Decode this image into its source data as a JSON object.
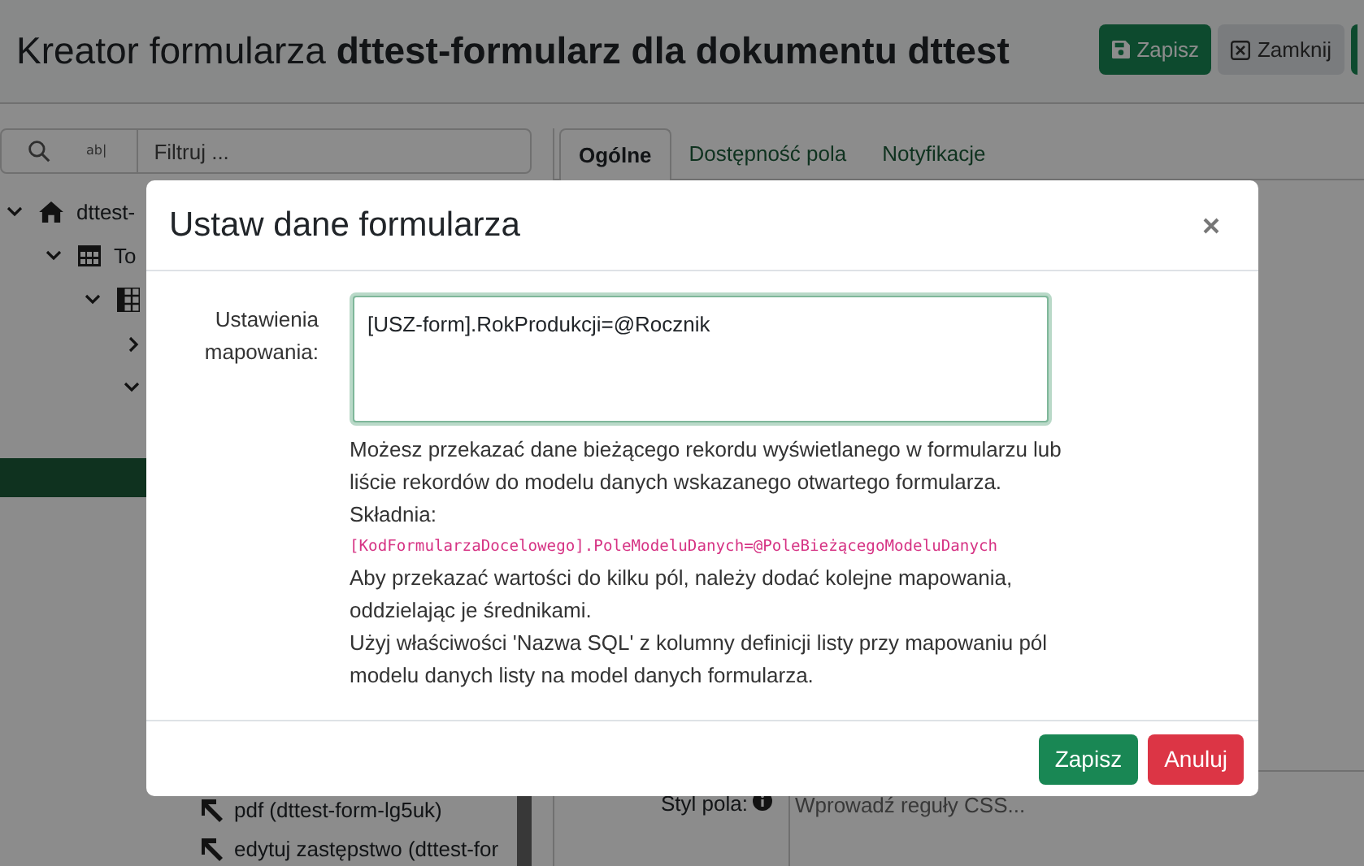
{
  "header": {
    "title_prefix": "Kreator formularza",
    "title_name": "dttest-formularz dla dokumentu dttest",
    "buttons": [
      {
        "label": "Zapisz",
        "kind": "save"
      },
      {
        "label": "Zamknij",
        "kind": "close"
      }
    ]
  },
  "tree_panel": {
    "regex_toggle": "ab|",
    "filter_placeholder": "Filtruj ...",
    "tree": [
      {
        "label": "dttest-",
        "expanded": true,
        "kind": "home",
        "children": [
          {
            "label": "To",
            "expanded": true,
            "kind": "table",
            "children": [
              {
                "expanded": true,
                "kind": "columns",
                "children": [
                  {
                    "expanded": false
                  },
                  {
                    "expanded": true
                  }
                ]
              }
            ]
          }
        ]
      }
    ],
    "actions": [
      {
        "label": "pdf (dttest-form-lg5uk)"
      },
      {
        "label": "edytuj zastępstwo (dttest-for"
      }
    ]
  },
  "properties_panel": {
    "tabs": [
      {
        "label": "Ogólne",
        "selected": true
      },
      {
        "label": "Dostępność pola",
        "selected": false
      },
      {
        "label": "Notyfikacje",
        "selected": false
      }
    ],
    "style_label": "Styl pola:",
    "style_placeholder": "Wprowadź reguły CSS..."
  },
  "dialog": {
    "title": "Ustaw dane formularza",
    "field_label": "Ustawienia mapowania:",
    "field_value": "[USZ-form].RokProdukcji=@Rocznik",
    "help": [
      {
        "kind": "text",
        "text": "Możesz przekazać dane bieżącego rekordu wyświetlanego w formularzu lub liście rekordów do modelu danych wskazanego otwartego formularza."
      },
      {
        "kind": "text",
        "text": "Składnia:"
      },
      {
        "kind": "code",
        "text": "[KodFormularzaDocelowego].PoleModeluDanych=@PoleBieżącegoModeluDanych"
      },
      {
        "kind": "text",
        "text": "Aby przekazać wartości do kilku pól, należy dodać kolejne mapowania, oddzielając je średnikami."
      },
      {
        "kind": "text",
        "text": "Użyj właściwości 'Nazwa SQL' z kolumny definicji listy przy mapowaniu pól modelu danych listy na model danych formularza."
      }
    ],
    "buttons": [
      {
        "label": "Zapisz",
        "kind": "primary"
      },
      {
        "label": "Anuluj",
        "kind": "danger"
      }
    ]
  }
}
